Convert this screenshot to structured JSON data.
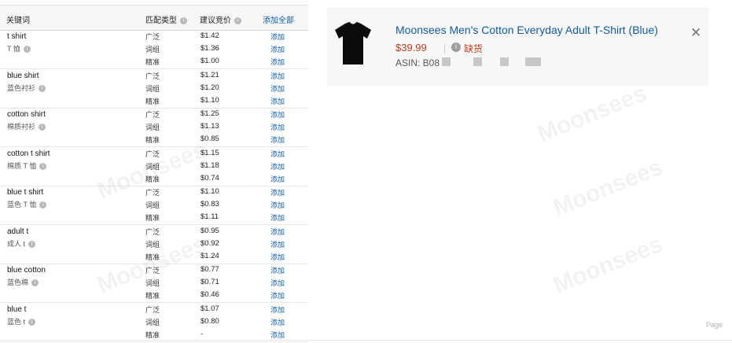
{
  "table": {
    "headers": {
      "keyword": "关键词",
      "match_type": "匹配类型",
      "bid": "建议竞价",
      "add_all": "添加全部"
    },
    "match_labels": [
      "广泛",
      "词组",
      "精准"
    ],
    "add_label": "添加",
    "groups": [
      {
        "en": "t shirt",
        "cn": "T 恤",
        "bids": [
          "$1.42",
          "$1.36",
          "$1.00"
        ]
      },
      {
        "en": "blue shirt",
        "cn": "蓝色衬衫",
        "bids": [
          "$1.21",
          "$1.20",
          "$1.10"
        ]
      },
      {
        "en": "cotton shirt",
        "cn": "棉质衬衫",
        "bids": [
          "$1.25",
          "$1.13",
          "$0.85"
        ]
      },
      {
        "en": "cotton t shirt",
        "cn": "棉质 T 恤",
        "bids": [
          "$1.15",
          "$1.18",
          "$0.74"
        ]
      },
      {
        "en": "blue t shirt",
        "cn": "蓝色 T 恤",
        "bids": [
          "$1.10",
          "$0.83",
          "$1.11"
        ]
      },
      {
        "en": "adult t",
        "cn": "成人 t",
        "bids": [
          "$0.95",
          "$0.92",
          "$1.24"
        ]
      },
      {
        "en": "blue cotton",
        "cn": "蓝色棉",
        "bids": [
          "$0.77",
          "$0.71",
          "$0.46"
        ]
      },
      {
        "en": "blue t",
        "cn": "蓝色 t",
        "bids": [
          "$1.07",
          "$0.80",
          "-"
        ]
      }
    ]
  },
  "product": {
    "title": "Moonsees Men's Cotton Everyday Adult T-Shirt (Blue)",
    "price": "$39.99",
    "stock_status": "缺货",
    "asin": "ASIN: B08"
  },
  "icons": {
    "info": "info-icon",
    "close": "close-icon",
    "warning": "info-circle-icon"
  },
  "footer": {
    "page_label": "Page"
  },
  "colors": {
    "link": "#0f5aa0",
    "price": "#c23c1a",
    "card_bg": "#f7f7f8"
  }
}
